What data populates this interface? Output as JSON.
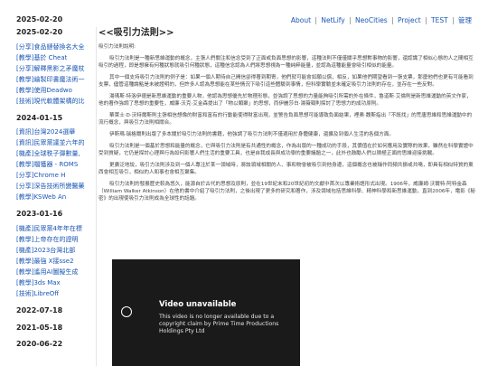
{
  "site": {
    "date": "2025-02-20",
    "nav": {
      "about": "About",
      "netlify": "NetLify",
      "neocities": "NeoCities",
      "project": "Project",
      "test": "TEST",
      "admin": "管理"
    }
  },
  "sidebar": {
    "sections": [
      {
        "date": "",
        "items": [
          "[分享]食品鏈替換名大全",
          "[教學]基於 Cheat",
          "[分享]解釋黑影之矛魔杖",
          "[教學]繪製印書魔法術一",
          "[教學]使用Deadwo",
          "[技術]現代軟體架構的比"
        ]
      },
      {
        "date": "2024-01-15",
        "items": [
          "[資訊]台灣2024選舉",
          "[資訊]民眾黨議並六年的",
          "[機產]全球秩子彈數量,",
          "[教學]檔獲器 - ROMS",
          "[分享]Chrome H",
          "[分享]深告技術所變醫藥",
          "[教學]KSWeb An"
        ]
      },
      {
        "date": "2023-01-16",
        "items": [
          "[機產]民眾黨4年年在標",
          "[教學]上帝存在的證明",
          "[機產]2023台灣北部",
          "[教學]最強 X接sse2",
          "[教學]遙用AI圖擬生成",
          "[教學]3ds Max",
          "[技術]LibreOff"
        ]
      },
      {
        "date": "2022-07-18",
        "items": []
      },
      {
        "date": "2021-05-18",
        "items": []
      },
      {
        "date": "2020-06-22",
        "items": []
      }
    ]
  },
  "article": {
    "title": "<<吸引力法則>>",
    "paragraphs": [
      "吸引力法則說明:",
      "吸引力法則是一種新思維運動的概念，主張人們關注和信念受到了正面或負面思想的影響，這種法則不僅僅關乎思想對事物的影響，還認識了相似心態的人之間相互吸引的過程，即是想擁有何種狀態就吸引何種狀態，這種信念認為人們將思想視為一種純粹能量，並認為這種能量會吸引相似的能量。",
      "其中一個支持吸引力法則的例子是：如果一個人期待自己開信卻得著到期寄，他們就可能會如願以償，相反，如果他們期望看到一張支票，那麼他們也更有可能看到支票，儘管這種論點是未被證明的，但許多人認為思想能在某些情況下吸引這些體驗到事情，但科學實驗並未確定吸引力法則的存在，並存在一些反對。",
      "湯瑪斯·特洛伊德是新思維運動的重要人物，他認為思想優先於物理形態，並強調了思想的力量能夠吸引所需的外在條件，魯道斯·艾倫則是新思維運動的英文作家，他的著作強調了思想的重要性，威廉·沃克·艾金森提出了「物以類聚」的思想，而伊麗莎白·湯薇頓則探討了思想力的成功原則。",
      "華萊士·D·沃特爾斯則主張相信想像的財富和富有的行動能使得財富出現，並警告負面思想可能導致負面結果，裡奧·魏斯指出「不既找」的荒唐思維和思維運動中的流行概念，與吸引力法則相關合。",
      "伊斯瑪·瑞格爾則出版了多本關於吸引力法則的書籍，他強調了吸引力法則不僅適用於身體健康，還擴及到個人生活的各個方面。",
      "吸引力法則是一個基於思想和能量的概念，它與吸引力法則是有共通性的概念，作為出版的一種成功的手段，其價值在於如何應用及實際的效果，雖然在科學實證中受到質疑，它仍是探討心理與行為如何影響人們生活的重要工具，也是自我成長與成功學的重要議題之一，此外也鼓勵人們以積極正面的思維迎接挑戰。",
      "更廣泛地說，吸引力法則涉及到一個人專注於某一領域時，將該領域相關的人、事和物會被吸引到他身邊，這個概念也被稱作同頻共振或共鳴，即具有相似特質的東西會相互吸引，相似的人和事也會相互聚集。",
      "吸引力法則的發展歷史較為悠久，能源自於古代的思想及原則，並在19世紀末和20世紀初的文獻中首次以專業術語形式出現。1906年，威廉姆·沃爾特·阿特金森（William Walker Atkinson）在他的書中介紹了吸引力法則，之後出現了更多的研究和著作，涉及領域包括思維科學、精神科學和新思維運動，直到2006年，電影《秘密》的出現使吸引力法則成為全球性的話題。"
    ]
  },
  "video": {
    "title": "Video unavailable",
    "message": "This video is no longer available due to a copyright claim by Prime Time Productions Holdings Pty Ltd"
  }
}
